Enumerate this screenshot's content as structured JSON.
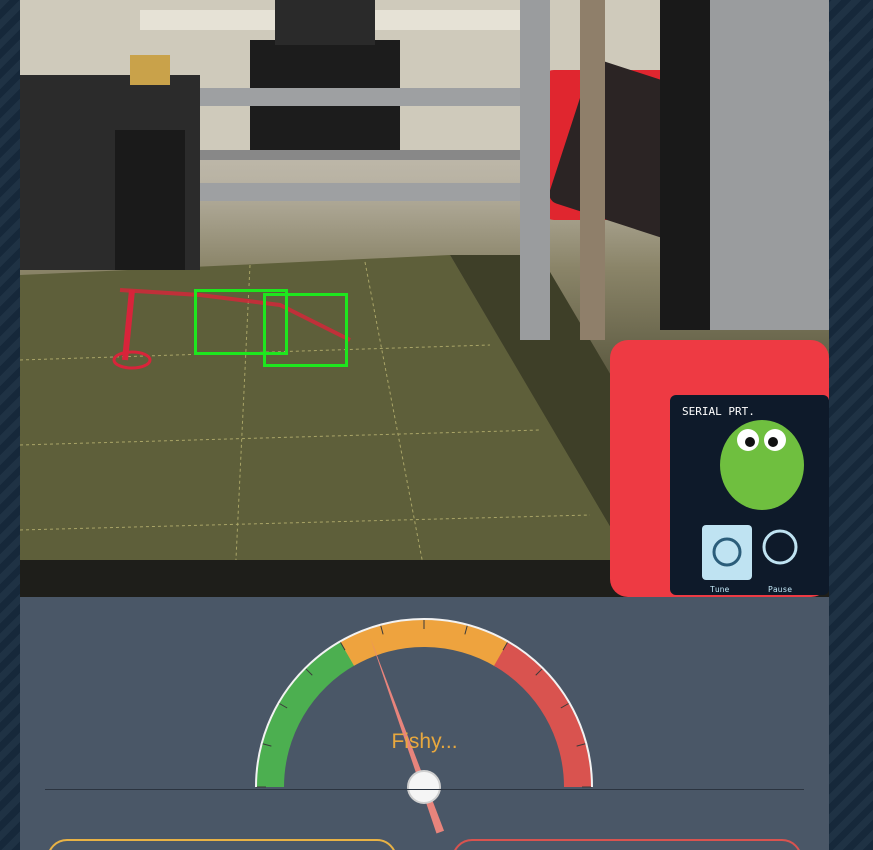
{
  "webcam": {
    "screen_text": "SERIAL PRT.",
    "tune_label": "Tune",
    "pause_label": "Pause"
  },
  "gauge": {
    "status_label": "Fishy...",
    "level": 0.39,
    "zones": [
      {
        "name": "good",
        "color": "#4caf50"
      },
      {
        "name": "warning",
        "color": "#eea33e"
      },
      {
        "name": "failure",
        "color": "#d9534f"
      }
    ]
  },
  "colors": {
    "background": "#4a5767",
    "detection_box": "#1ee61e",
    "button_left_border": "#e8b245",
    "button_right_border": "#d9534f"
  }
}
